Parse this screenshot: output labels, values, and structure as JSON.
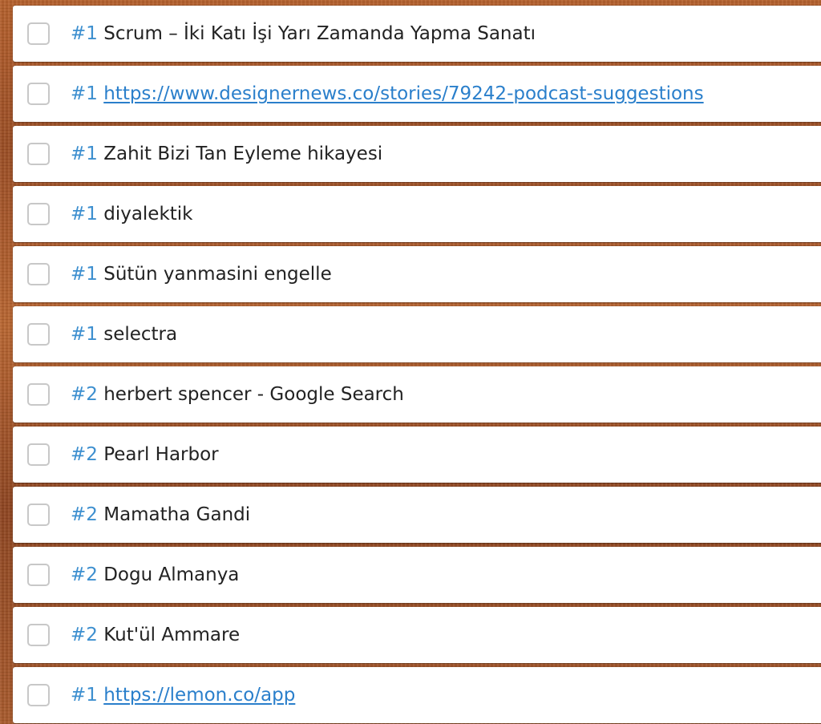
{
  "tasks": [
    {
      "num": "#1",
      "title": "Scrum – İki Katı İşi Yarı Zamanda Yapma Sanatı",
      "link": false
    },
    {
      "num": "#1",
      "title": "https://www.designernews.co/stories/79242-podcast-suggestions",
      "link": true
    },
    {
      "num": "#1",
      "title": "Zahit Bizi Tan Eyleme hikayesi",
      "link": false
    },
    {
      "num": "#1",
      "title": "diyalektik",
      "link": false
    },
    {
      "num": "#1",
      "title": "Sütün yanmasini engelle",
      "link": false
    },
    {
      "num": "#1",
      "title": "selectra",
      "link": false
    },
    {
      "num": "#2",
      "title": "herbert spencer - Google Search",
      "link": false
    },
    {
      "num": "#2",
      "title": "Pearl Harbor",
      "link": false
    },
    {
      "num": "#2",
      "title": "Mamatha Gandi",
      "link": false
    },
    {
      "num": "#2",
      "title": "Dogu Almanya",
      "link": false
    },
    {
      "num": "#2",
      "title": "Kut'ül Ammare",
      "link": false
    },
    {
      "num": "#1",
      "title": "https://lemon.co/app",
      "link": true
    }
  ],
  "colors": {
    "number": "#3d8fcf",
    "link": "#2a7fcb",
    "text": "#222222",
    "background": "#a85a2b"
  }
}
